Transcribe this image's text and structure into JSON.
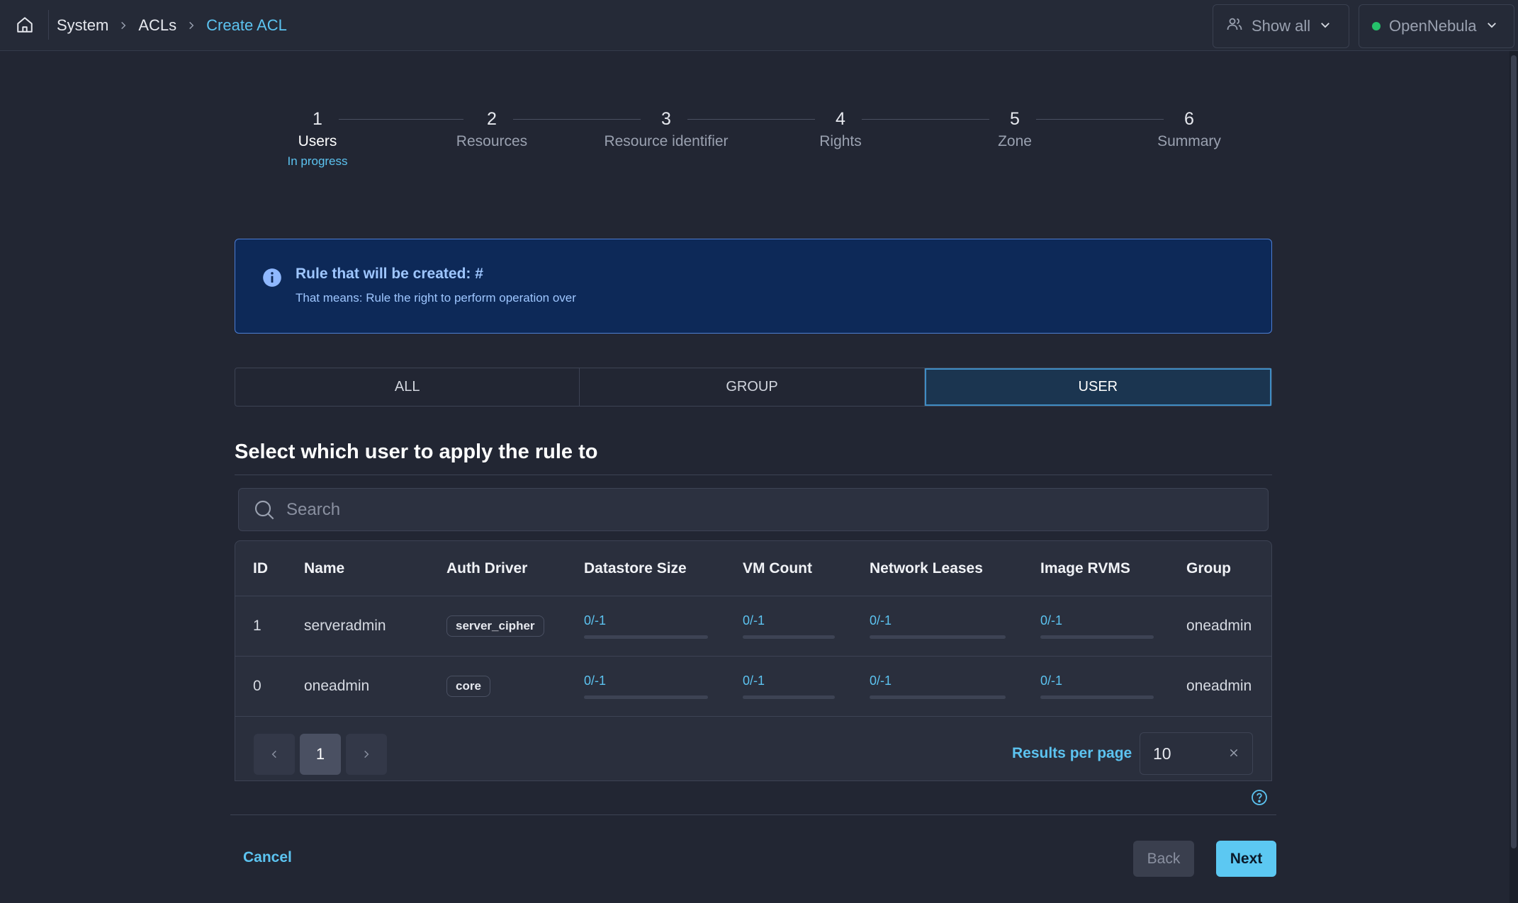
{
  "breadcrumb": {
    "items": [
      "System",
      "ACLs"
    ],
    "current": "Create ACL"
  },
  "header": {
    "show_all_label": "Show all",
    "zone_label": "OpenNebula",
    "zone_status_color": "#25c06a"
  },
  "stepper": {
    "steps": [
      {
        "number": "1",
        "label": "Users",
        "status": "In progress"
      },
      {
        "number": "2",
        "label": "Resources"
      },
      {
        "number": "3",
        "label": "Resource identifier"
      },
      {
        "number": "4",
        "label": "Rights"
      },
      {
        "number": "5",
        "label": "Zone"
      },
      {
        "number": "6",
        "label": "Summary"
      }
    ]
  },
  "banner": {
    "title": "Rule that will be created: #",
    "text": "That means: Rule the right to perform operation over"
  },
  "tabs": {
    "items": [
      "ALL",
      "GROUP",
      "USER"
    ],
    "selected": "USER"
  },
  "section": {
    "title": "Select which user to apply the rule to"
  },
  "search": {
    "placeholder": "Search",
    "value": ""
  },
  "table": {
    "columns": [
      "ID",
      "Name",
      "Auth Driver",
      "Datastore Size",
      "VM Count",
      "Network Leases",
      "Image RVMS",
      "Group"
    ],
    "rows": [
      {
        "id": "1",
        "name": "serveradmin",
        "auth_driver": "server_cipher",
        "datastore_size": "0/-1",
        "vm_count": "0/-1",
        "network_leases": "0/-1",
        "image_rvms": "0/-1",
        "group": "oneadmin"
      },
      {
        "id": "0",
        "name": "oneadmin",
        "auth_driver": "core",
        "datastore_size": "0/-1",
        "vm_count": "0/-1",
        "network_leases": "0/-1",
        "image_rvms": "0/-1",
        "group": "oneadmin"
      }
    ]
  },
  "pagination": {
    "current_page": "1",
    "results_per_page_label": "Results per page",
    "results_per_page": "10"
  },
  "footer": {
    "cancel_label": "Cancel",
    "back_label": "Back",
    "next_label": "Next"
  },
  "colors": {
    "accent": "#5cc3f0",
    "banner_bg": "#0d2958",
    "background": "#222633"
  }
}
